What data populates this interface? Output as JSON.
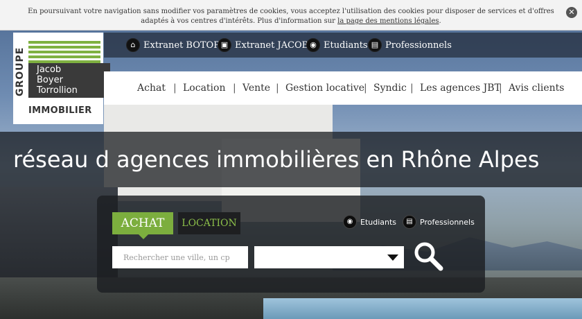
{
  "cookie": {
    "text": "En poursuivant votre navigation sans modifier vos paramètres de cookies, vous acceptez l'utilisation des cookies pour disposer de services et d'offres adaptés à vos centres d'intérêts. Plus d'information sur",
    "link": "la page des mentions légales",
    "after": ".",
    "close": "✕"
  },
  "logo": {
    "groupe": "GROUPE",
    "line1": "Jacob",
    "line2": "Boyer",
    "line3": "Torrollion",
    "immobilier": "IMMOBILIER"
  },
  "topbar": {
    "items": [
      {
        "label": "Extranet BOTOR",
        "icon": "home-icon",
        "glyph": "⌂"
      },
      {
        "label": "Extranet JACOB",
        "icon": "box-icon",
        "glyph": "▣"
      },
      {
        "label": "Etudiants",
        "icon": "student-icon",
        "glyph": "◉"
      },
      {
        "label": "Professionnels",
        "icon": "briefcase-icon",
        "glyph": "▤"
      }
    ]
  },
  "nav": {
    "items": [
      "Achat",
      "Location",
      "Vente",
      "Gestion locative",
      "Syndic",
      "Les agences JBT",
      "Avis clients"
    ],
    "sep": "|"
  },
  "tagline": "réseau d agences immobilières en Rhône Alpes",
  "search": {
    "tab_achat": "ACHAT",
    "tab_location": "LOCATION",
    "opt_etudiants": "Etudiants",
    "opt_professionnels": "Professionnels",
    "placeholder": "Rechercher une ville, un cp",
    "select_value": ""
  },
  "colors": {
    "accent_green": "#7cae3e",
    "dark_panel": "#1c1e22"
  }
}
